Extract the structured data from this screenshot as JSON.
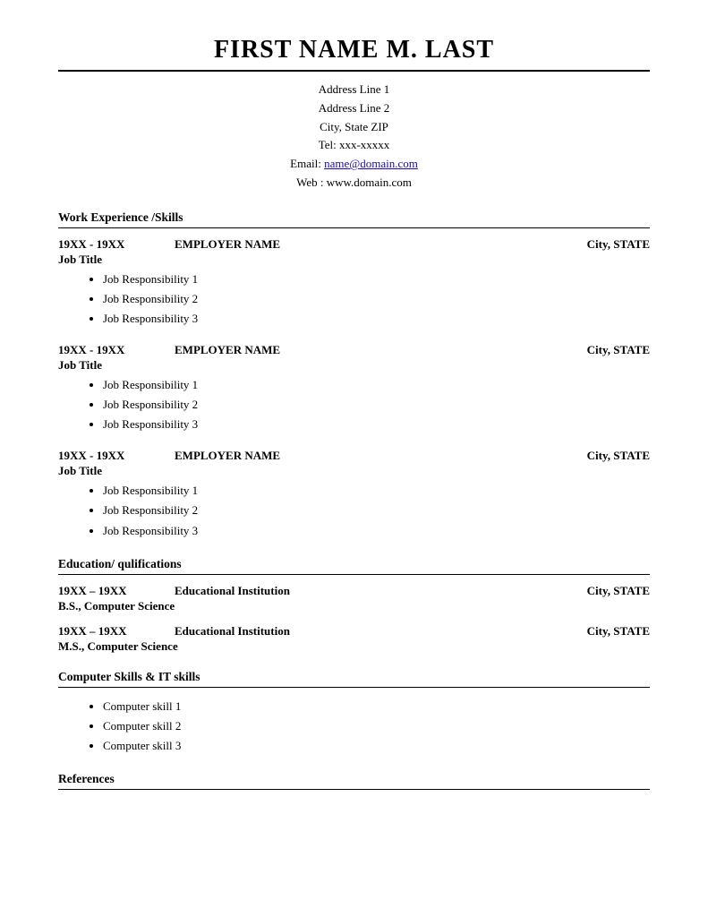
{
  "header": {
    "name": "FIRST NAME M. LAST",
    "address_line1": "Address Line 1",
    "address_line2": "Address Line 2",
    "city_state_zip": "City, State ZIP",
    "tel": "Tel: xxx-xxxxx",
    "email_label": "Email: ",
    "email_link": "name@domain.com",
    "email_href": "mailto:name@domain.com",
    "web": "Web : www.domain.com"
  },
  "sections": {
    "work_experience": {
      "title": "Work Experience /Skills",
      "jobs": [
        {
          "dates": "19XX - 19XX",
          "employer": "EMPLOYER NAME",
          "location": "City, STATE",
          "title": "Job Title",
          "responsibilities": [
            "Job Responsibility 1",
            "Job Responsibility 2",
            "Job Responsibility 3"
          ]
        },
        {
          "dates": "19XX - 19XX",
          "employer": "EMPLOYER NAME",
          "location": "City, STATE",
          "title": "Job Title",
          "responsibilities": [
            "Job Responsibility 1",
            "Job Responsibility 2",
            "Job Responsibility 3"
          ]
        },
        {
          "dates": "19XX - 19XX",
          "employer": "EMPLOYER NAME",
          "location": "City, STATE",
          "title": "Job Title",
          "responsibilities": [
            "Job Responsibility 1",
            "Job Responsibility 2",
            "Job Responsibility 3"
          ]
        }
      ]
    },
    "education": {
      "title": "Education/ qulifications",
      "entries": [
        {
          "dates": "19XX – 19XX",
          "institution": "Educational Institution",
          "location": "City, STATE",
          "degree": "B.S., Computer Science"
        },
        {
          "dates": "19XX – 19XX",
          "institution": "Educational Institution",
          "location": "City, STATE",
          "degree": "M.S., Computer Science"
        }
      ]
    },
    "computer_skills": {
      "title": "Computer Skills & IT skills",
      "skills": [
        "Computer skill 1",
        "Computer skill 2",
        "Computer skill 3"
      ]
    },
    "references": {
      "title": "References"
    }
  }
}
